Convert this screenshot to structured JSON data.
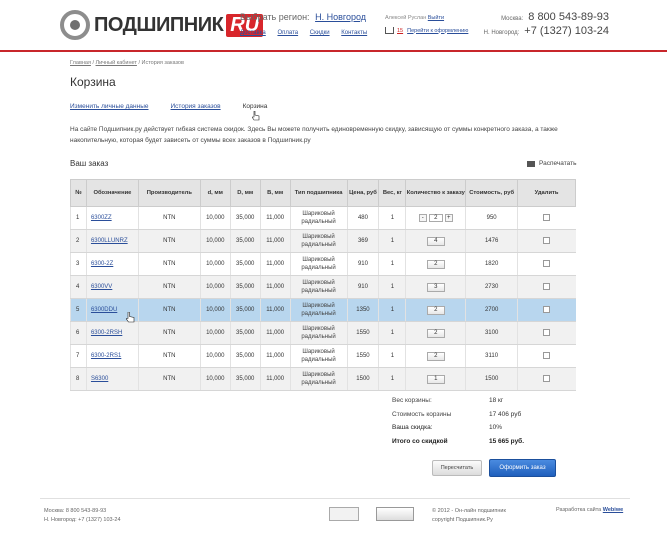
{
  "header": {
    "logo_text": "ПОДШИПНИК",
    "logo_ru": "RU",
    "region_label": "Выбрать регион:",
    "region_value": "Н. Новгород",
    "nav": [
      "Доставка",
      "Оплата",
      "Скидки",
      "Контакты"
    ],
    "login_label": "Алексей Руслан",
    "logout": "Выйти",
    "cart_count": "15",
    "cart_link": "Перейти к оформлению",
    "phones": [
      {
        "city": "Москва:",
        "number": "8 800 543-89-93"
      },
      {
        "city": "Н. Новгород:",
        "number": "+7 (1327) 103-24"
      }
    ]
  },
  "breadcrumbs": [
    "Главная",
    "Личный кабинет",
    "История заказов"
  ],
  "page_title": "Корзина",
  "tabs": [
    "Изменить личные данные",
    "История заказов",
    "Корзина"
  ],
  "intro": "На сайте Подшипник.ру действует гибкая система скидок. Здесь Вы можете получить единовременную скидку, зависящую от суммы конкретного заказа, а также накопительную, которая будет зависеть от суммы всех заказов в Подшипник.ру",
  "order_title": "Ваш заказ",
  "print_label": "Распечатать",
  "table": {
    "headers": [
      "№",
      "Обозначение",
      "Производитель",
      "d, мм",
      "D, мм",
      "B, мм",
      "Тип подшипника",
      "Цена, руб",
      "Вес, кг",
      "Количество к заказу",
      "Стоимость, руб",
      "Удалить"
    ],
    "rows": [
      {
        "n": "1",
        "code": "6300ZZ",
        "maker": "NTN",
        "d": "10,000",
        "D": "35,000",
        "B": "11,000",
        "type1": "Шариковый",
        "type2": "радиальный",
        "price": "480",
        "weight": "1",
        "qty": "2",
        "stepper": true,
        "cost": "950"
      },
      {
        "n": "2",
        "code": "6300LLUNRZ",
        "maker": "NTN",
        "d": "10,000",
        "D": "35,000",
        "B": "11,000",
        "type1": "Шариковый",
        "type2": "радиальный",
        "price": "369",
        "weight": "1",
        "qty": "4",
        "stepper": false,
        "cost": "1476"
      },
      {
        "n": "3",
        "code": "6300-2Z",
        "maker": "NTN",
        "d": "10,000",
        "D": "35,000",
        "B": "11,000",
        "type1": "Шариковый",
        "type2": "радиальный",
        "price": "910",
        "weight": "1",
        "qty": "2",
        "stepper": false,
        "cost": "1820"
      },
      {
        "n": "4",
        "code": "6300VV",
        "maker": "NTN",
        "d": "10,000",
        "D": "35,000",
        "B": "11,000",
        "type1": "Шариковый",
        "type2": "радиальный",
        "price": "910",
        "weight": "1",
        "qty": "3",
        "stepper": false,
        "cost": "2730"
      },
      {
        "n": "5",
        "code": "6300DDU",
        "maker": "NTN",
        "d": "10,000",
        "D": "35,000",
        "B": "11,000",
        "type1": "Шариковый",
        "type2": "радиальный",
        "price": "1350",
        "weight": "1",
        "qty": "2",
        "stepper": false,
        "cost": "2700"
      },
      {
        "n": "6",
        "code": "6300-2RSH",
        "maker": "NTN",
        "d": "10,000",
        "D": "35,000",
        "B": "11,000",
        "type1": "Шариковый",
        "type2": "радиальный",
        "price": "1550",
        "weight": "1",
        "qty": "2",
        "stepper": false,
        "cost": "3100"
      },
      {
        "n": "7",
        "code": "6300-2RS1",
        "maker": "NTN",
        "d": "10,000",
        "D": "35,000",
        "B": "11,000",
        "type1": "Шариковый",
        "type2": "радиальный",
        "price": "1550",
        "weight": "1",
        "qty": "2",
        "stepper": false,
        "cost": "3110"
      },
      {
        "n": "8",
        "code": "S6300",
        "maker": "NTN",
        "d": "10,000",
        "D": "35,000",
        "B": "11,000",
        "type1": "Шариковый",
        "type2": "радиальный",
        "price": "1500",
        "weight": "1",
        "qty": "1",
        "stepper": false,
        "cost": "1500"
      }
    ]
  },
  "summary": [
    {
      "label": "Вес корзины:",
      "value": "18 кг"
    },
    {
      "label": "Стоимость корзины",
      "value": "17 406 руб"
    },
    {
      "label": "Ваша скидка:",
      "value": "10%"
    },
    {
      "label": "Итого со скидкой",
      "value": "15 665 руб."
    }
  ],
  "buttons": {
    "recalc": "Пересчитать",
    "order": "Оформить заказ"
  },
  "footer": {
    "phone1": "Москва: 8 800 543-89-93",
    "phone2": "Н. Новгород: +7 (1327) 103-24",
    "copy1": "© 2012 - Он-лайн подшипник",
    "copy2": "copyright Подшипник.Ру",
    "dev_label": "Разработка сайта",
    "dev_link": "Webiwe"
  }
}
